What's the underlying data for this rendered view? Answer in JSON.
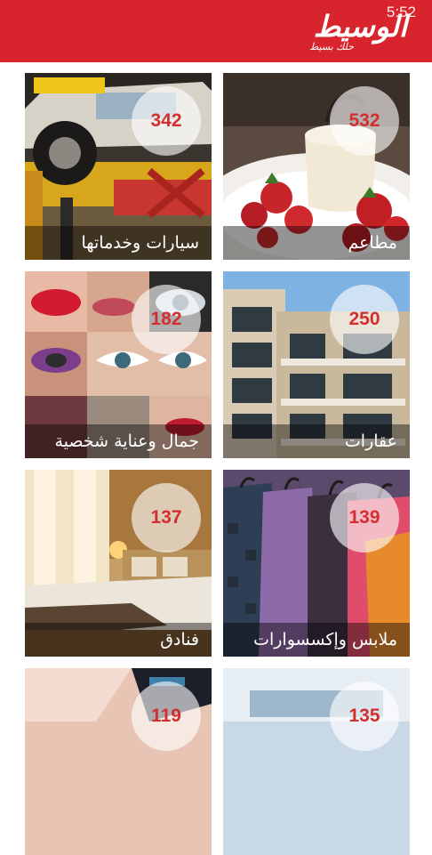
{
  "status_bar": {
    "time": "5:52"
  },
  "header": {
    "logo_text": "الوسيط",
    "logo_tagline": "حلك بسيط"
  },
  "categories": [
    {
      "label": "مطاعم",
      "count": "532"
    },
    {
      "label": "سيارات وخدماتها",
      "count": "342"
    },
    {
      "label": "عقارات",
      "count": "250"
    },
    {
      "label": "جمال وعناية شخصية",
      "count": "182"
    },
    {
      "label": "ملابس وإكسسوارات",
      "count": "139"
    },
    {
      "label": "فنادق",
      "count": "137"
    },
    {
      "label": "",
      "count": "135"
    },
    {
      "label": "",
      "count": "119"
    }
  ],
  "colors": {
    "header": "#d8242c",
    "count_text": "#d32f2f"
  }
}
